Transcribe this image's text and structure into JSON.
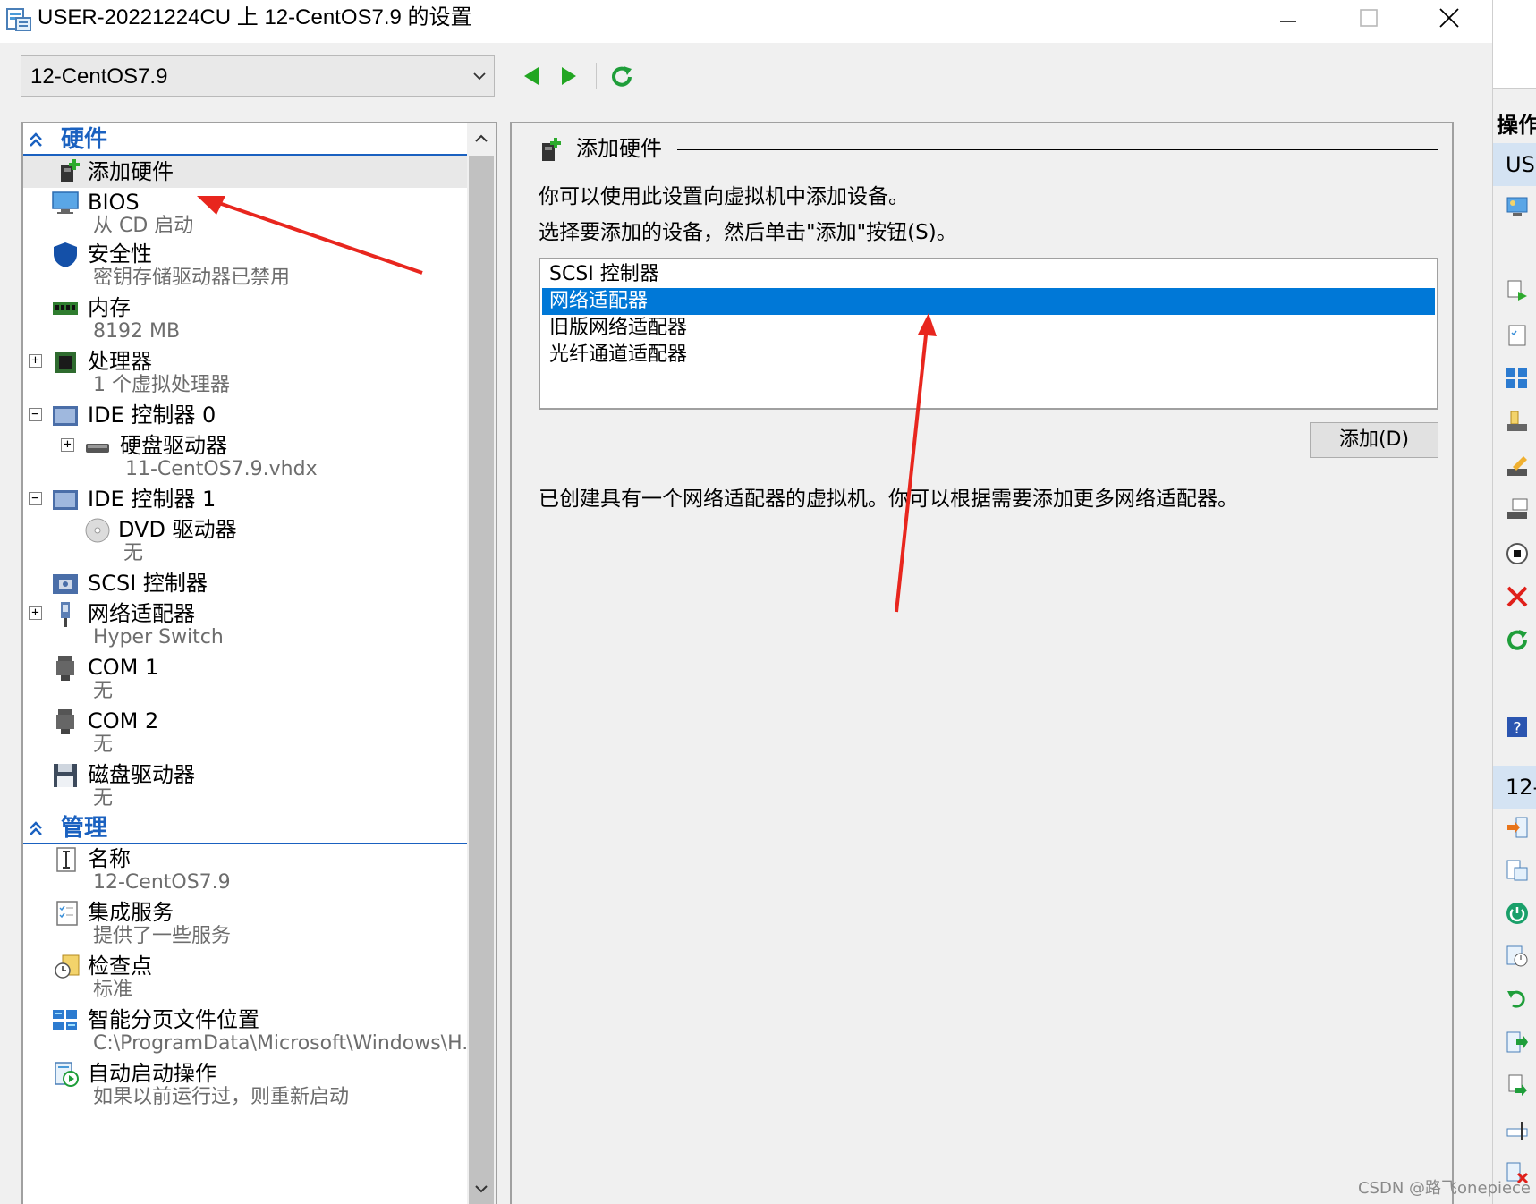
{
  "window": {
    "title": "USER-20221224CU 上 12-CentOS7.9 的设置"
  },
  "toolbar": {
    "vm_selected": "12-CentOS7.9"
  },
  "tree": {
    "hardware_header": "硬件",
    "management_header": "管理",
    "items": [
      {
        "name": "添加硬件"
      },
      {
        "name": "BIOS",
        "sub": "从 CD 启动"
      },
      {
        "name": "安全性",
        "sub": "密钥存储驱动器已禁用"
      },
      {
        "name": "内存",
        "sub": "8192 MB"
      },
      {
        "name": "处理器",
        "sub": "1 个虚拟处理器"
      },
      {
        "name": "IDE 控制器 0"
      },
      {
        "name": "硬盘驱动器",
        "sub": "11-CentOS7.9.vhdx"
      },
      {
        "name": "IDE 控制器 1"
      },
      {
        "name": "DVD 驱动器",
        "sub": "无"
      },
      {
        "name": "SCSI 控制器"
      },
      {
        "name": "网络适配器",
        "sub": "Hyper Switch"
      },
      {
        "name": "COM 1",
        "sub": "无"
      },
      {
        "name": "COM 2",
        "sub": "无"
      },
      {
        "name": "磁盘驱动器",
        "sub": "无"
      }
    ],
    "mgmt_items": [
      {
        "name": "名称",
        "sub": "12-CentOS7.9"
      },
      {
        "name": "集成服务",
        "sub": "提供了一些服务"
      },
      {
        "name": "检查点",
        "sub": "标准"
      },
      {
        "name": "智能分页文件位置",
        "sub": "C:\\ProgramData\\Microsoft\\Windows\\H..."
      },
      {
        "name": "自动启动操作",
        "sub": "如果以前运行过，则重新启动"
      }
    ]
  },
  "detail": {
    "title": "添加硬件",
    "desc1": "你可以使用此设置向虚拟机中添加设备。",
    "desc2": "选择要添加的设备，然后单击\"添加\"按钮(S)。",
    "devices": [
      "SCSI 控制器",
      "网络适配器",
      "旧版网络适配器",
      "光纤通道适配器"
    ],
    "selected_device": "网络适配器",
    "add_button": "添加(D)",
    "note": "已创建具有一个网络适配器的虚拟机。你可以根据需要添加更多网络适配器。"
  },
  "right_strip": {
    "ops_label": "操作",
    "host_label": "US",
    "vm_label": "12-"
  },
  "watermark": "CSDN @路飞onepiece",
  "colors": {
    "accent": "#1a61c0",
    "selection": "#0078d7",
    "arrow": "#e8261e"
  }
}
